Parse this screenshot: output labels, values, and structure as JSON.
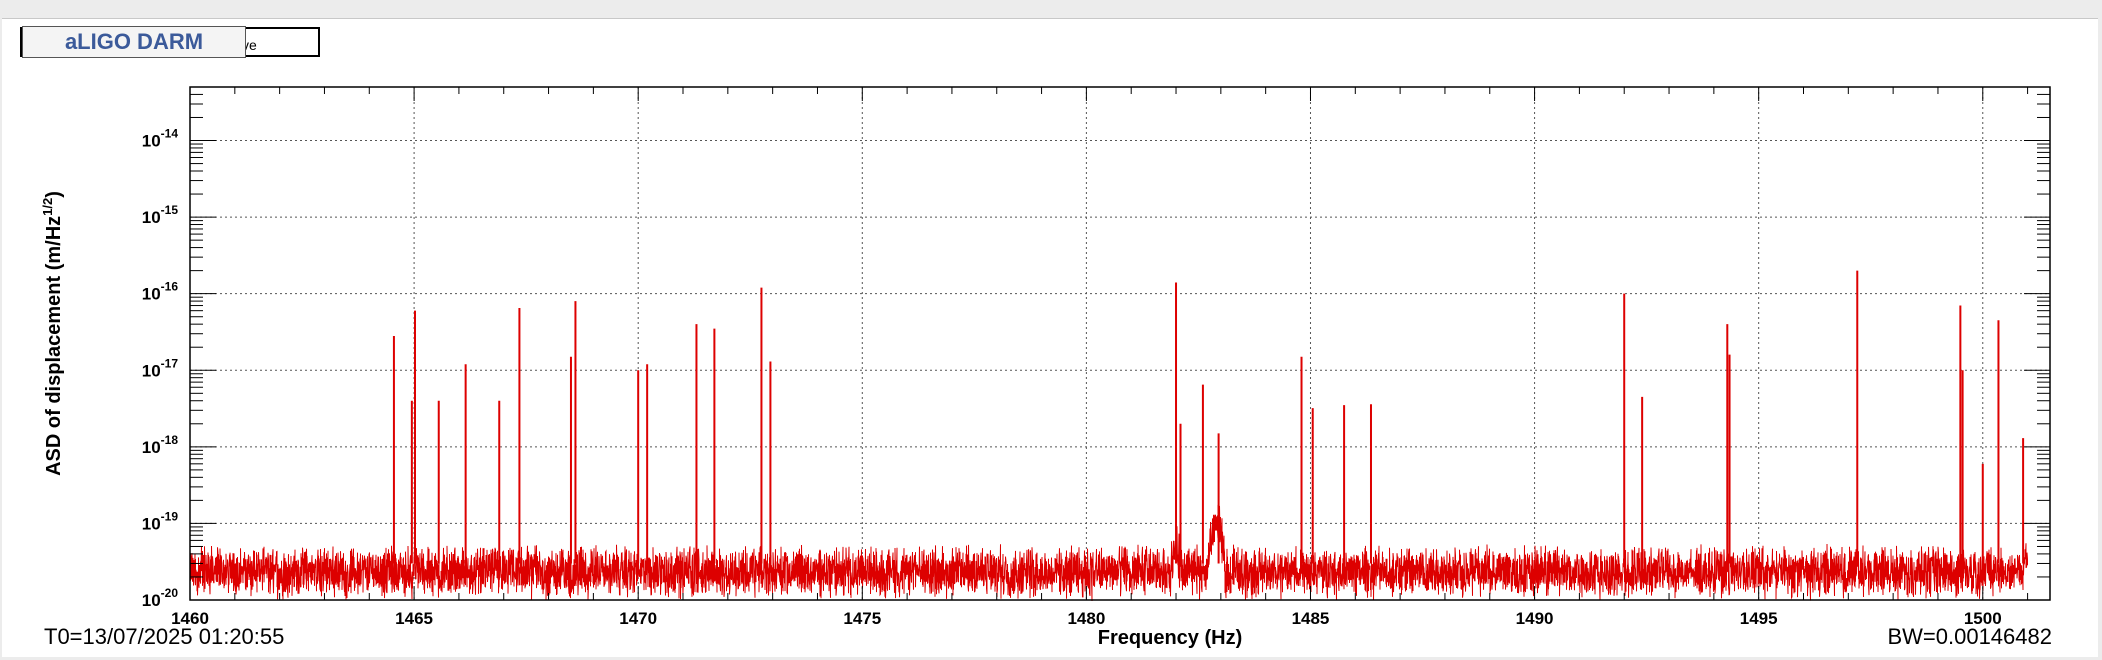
{
  "window": {
    "title": "aLIGO DARM",
    "legend_label": "ve"
  },
  "footer": {
    "t0": "T0=13/07/2025 01:20:55",
    "bw": "BW=0.00146482"
  },
  "colors": {
    "trace": "#dd0000",
    "title_text": "#3b5a9a",
    "grid": "#555555",
    "background": "#ffffff"
  },
  "chart_data": {
    "type": "line",
    "xlabel": "Frequency (Hz)",
    "ylabel_main": "ASD of displacement (m/Hz",
    "ylabel_sup": "1/2",
    "ylabel_tail": ")",
    "xlim": [
      1460,
      1501.5
    ],
    "ylim": [
      1e-20,
      5e-14
    ],
    "yscale": "log",
    "grid": true,
    "x_ticks": [
      1460,
      1465,
      1470,
      1475,
      1480,
      1485,
      1490,
      1495,
      1500
    ],
    "y_tick_exponents": [
      -20,
      -19,
      -18,
      -17,
      -16,
      -15,
      -14
    ],
    "noise_floor": {
      "x_range": [
        1460,
        1501
      ],
      "median": 3e-20,
      "min": 1.2e-20,
      "max": 5e-20
    },
    "broad_bumps": [
      {
        "x": 1482.0,
        "peak": 6e-20
      },
      {
        "x": 1482.9,
        "peak": 1.5e-19
      },
      {
        "x": 1501.0,
        "peak": 6e-20
      }
    ],
    "lines": [
      {
        "x": 1464.55,
        "y": 2.8e-17
      },
      {
        "x": 1464.95,
        "y": 4e-18
      },
      {
        "x": 1465.02,
        "y": 6e-17
      },
      {
        "x": 1465.55,
        "y": 4e-18
      },
      {
        "x": 1466.15,
        "y": 1.2e-17
      },
      {
        "x": 1466.9,
        "y": 4e-18
      },
      {
        "x": 1467.35,
        "y": 6.5e-17
      },
      {
        "x": 1468.5,
        "y": 1.5e-17
      },
      {
        "x": 1468.6,
        "y": 8e-17
      },
      {
        "x": 1470.0,
        "y": 1e-17
      },
      {
        "x": 1470.2,
        "y": 1.2e-17
      },
      {
        "x": 1471.3,
        "y": 4e-17
      },
      {
        "x": 1471.7,
        "y": 3.5e-17
      },
      {
        "x": 1472.75,
        "y": 1.2e-16
      },
      {
        "x": 1472.95,
        "y": 1.3e-17
      },
      {
        "x": 1482.0,
        "y": 1.4e-16
      },
      {
        "x": 1482.1,
        "y": 2e-18
      },
      {
        "x": 1482.6,
        "y": 6.5e-18
      },
      {
        "x": 1482.95,
        "y": 1.5e-18
      },
      {
        "x": 1484.8,
        "y": 1.5e-17
      },
      {
        "x": 1485.05,
        "y": 3.2e-18
      },
      {
        "x": 1485.75,
        "y": 3.5e-18
      },
      {
        "x": 1486.35,
        "y": 3.6e-18
      },
      {
        "x": 1492.0,
        "y": 1e-16
      },
      {
        "x": 1492.4,
        "y": 4.5e-18
      },
      {
        "x": 1494.3,
        "y": 4e-17
      },
      {
        "x": 1494.35,
        "y": 1.6e-17
      },
      {
        "x": 1497.2,
        "y": 2e-16
      },
      {
        "x": 1499.5,
        "y": 7e-17
      },
      {
        "x": 1499.55,
        "y": 1e-17
      },
      {
        "x": 1500.0,
        "y": 6e-19
      },
      {
        "x": 1500.35,
        "y": 4.5e-17
      },
      {
        "x": 1500.9,
        "y": 1.3e-18
      }
    ]
  }
}
